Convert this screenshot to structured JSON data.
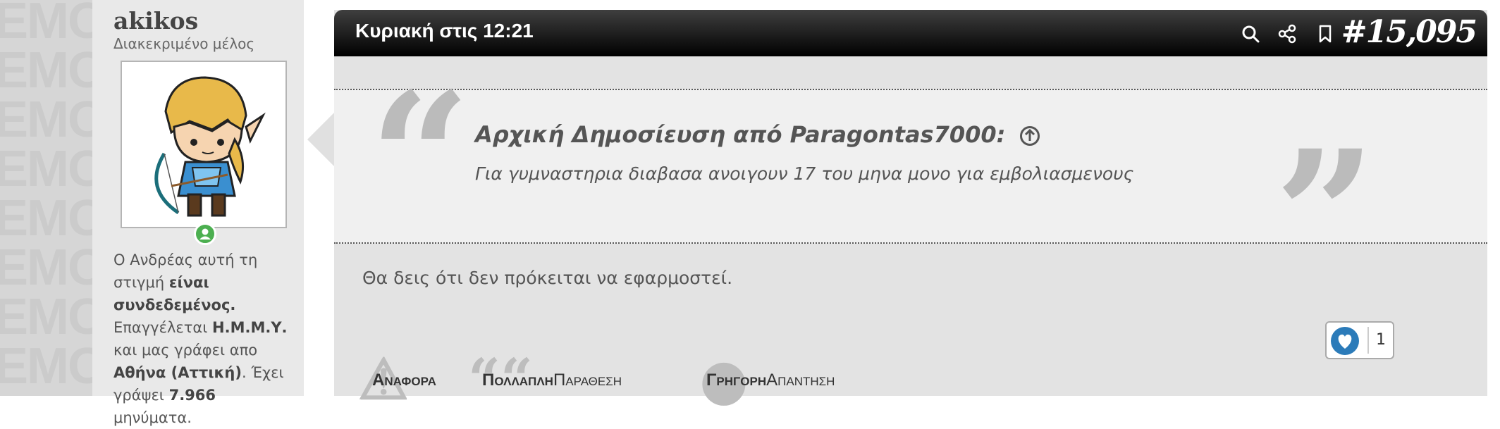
{
  "sidebar_watermark": "EMOTIKEXM",
  "user": {
    "name": "akikos",
    "title": "Διακεκριμένο μέλος",
    "bio_prefix": "Ο Ανδρέας αυτή τη στιγμή ",
    "bio_online": "είναι συνδεδεμένος.",
    "bio_occ_prefix": " Επαγγέλεται ",
    "bio_occ": "Η.Μ.Μ.Υ.",
    "bio_loc_prefix": " και μας γράφει απο ",
    "bio_loc": "Αθήνα (Αττική)",
    "bio_posts_prefix": ". Έχει γράψει ",
    "bio_posts": "7.966",
    "bio_posts_suffix": " μηνύματα."
  },
  "post": {
    "date": "Κυριακή στις 12:21",
    "number": "#15,095",
    "quote_author": "Αρχική Δημοσίευση από Paragontas7000:",
    "quote_text": "Για γυμναστηρια διαβασα ανοιγουν 17 του μηνα μονο για εμβολιασμενους",
    "message": "Θα δεις ότι δεν πρόκειται να εφαρμοστεί.",
    "like_count": "1",
    "actions": {
      "report": "Αναφορα",
      "multi_bold": "Πολλαπλη",
      "multi_rest": "Παραθεση",
      "quick_bold": "Γρηγορη",
      "quick_rest": "Απαντηση"
    }
  },
  "icons": [
    "search-icon",
    "share-icon",
    "bookmark-icon",
    "arrow-up-circle-icon",
    "heart-icon",
    "online-user-icon",
    "avatar-image"
  ],
  "colors": {
    "header_top": "#3f3f3f",
    "header_bottom": "#000000",
    "like_blue": "#2b7bb9",
    "online_green": "#4caf50"
  }
}
